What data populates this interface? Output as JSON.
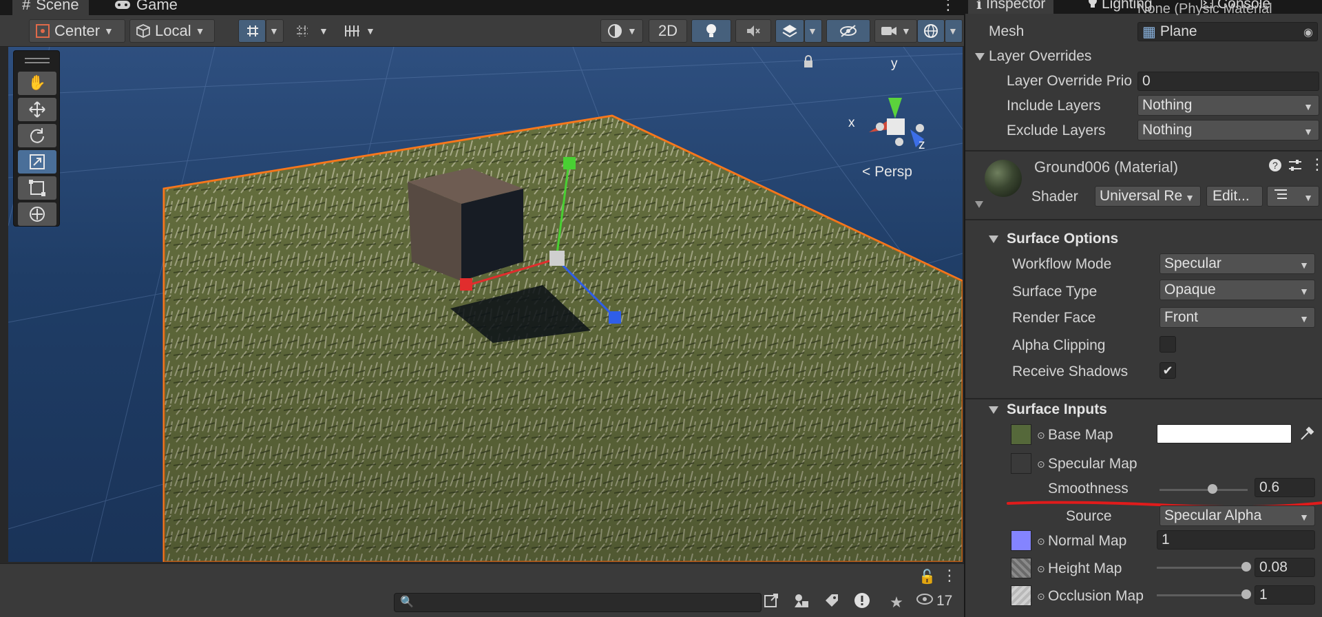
{
  "scene": {
    "tabs": [
      {
        "label": "Scene",
        "icon": "hash-icon"
      },
      {
        "label": "Game",
        "icon": "gamepad-icon"
      }
    ],
    "toolbar": {
      "pivot_label": "Center",
      "space_label": "Local",
      "mode_2d_label": "2D"
    },
    "view_label": "Persp",
    "gizmo_axes": {
      "x": "x",
      "y": "y",
      "z": "z"
    },
    "status": {
      "search_placeholder": "",
      "visible_count": "17"
    }
  },
  "inspector": {
    "tabs": [
      {
        "label": "Inspector",
        "icon": "info-icon"
      },
      {
        "label": "Lighting",
        "icon": "bulb-icon"
      },
      {
        "label": "Console",
        "icon": "console-icon"
      }
    ],
    "partial_top_text": "None (Physic Material",
    "mesh": {
      "label": "Mesh",
      "value": "Plane"
    },
    "layer_overrides": {
      "title": "Layer Overrides",
      "priority_label": "Layer Override Prio",
      "priority_value": "0",
      "include_label": "Include Layers",
      "include_value": "Nothing",
      "exclude_label": "Exclude Layers",
      "exclude_value": "Nothing"
    },
    "material": {
      "name": "Ground006 (Material)",
      "shader_label": "Shader",
      "shader_value": "Universal Re",
      "edit_label": "Edit..."
    },
    "surface_options": {
      "title": "Surface Options",
      "workflow_label": "Workflow Mode",
      "workflow_value": "Specular",
      "surface_type_label": "Surface Type",
      "surface_type_value": "Opaque",
      "render_face_label": "Render Face",
      "render_face_value": "Front",
      "alpha_clip_label": "Alpha Clipping",
      "alpha_clip_checked": false,
      "receive_shadows_label": "Receive Shadows",
      "receive_shadows_checked": true,
      "check_glyph": "✔"
    },
    "surface_inputs": {
      "title": "Surface Inputs",
      "base_map_label": "Base Map",
      "specular_map_label": "Specular Map",
      "smoothness_label": "Smoothness",
      "smoothness_value": "0.6",
      "smoothness": 0.6,
      "source_label": "Source",
      "source_value": "Specular Alpha",
      "normal_map_label": "Normal Map",
      "normal_map_value": "1",
      "height_map_label": "Height Map",
      "height_map_value": "0.08",
      "height": 0.08,
      "occlusion_map_label": "Occlusion Map",
      "occlusion_map_value": "1",
      "occlusion": 1.0
    }
  },
  "colors": {
    "accent_selection": "#ff7b1c",
    "annotation_red": "#e01b1b",
    "axis_x": "#e12d2d",
    "axis_y": "#49d033",
    "axis_z": "#2f5ee8"
  }
}
